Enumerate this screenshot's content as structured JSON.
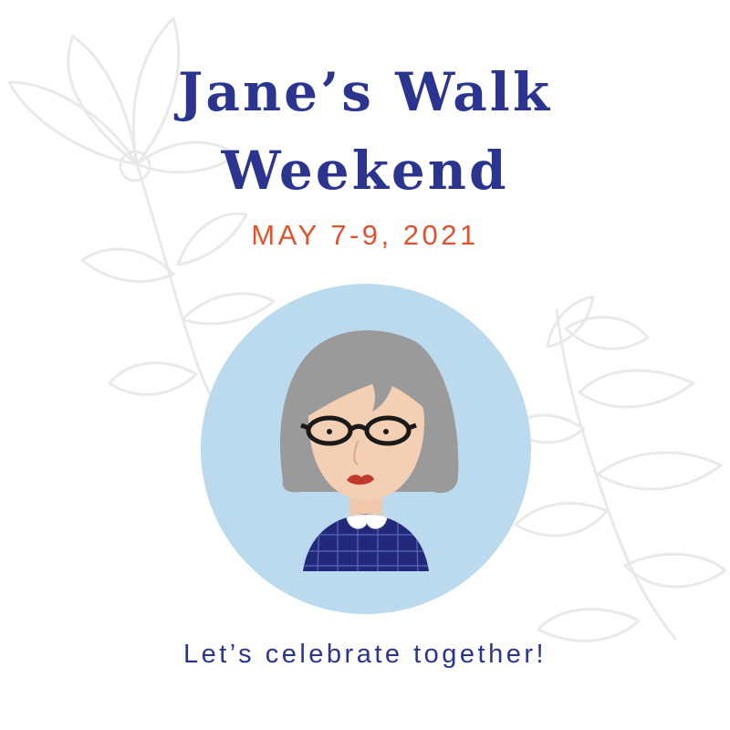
{
  "poster": {
    "title_line_1": "Jane’s Walk",
    "title_line_2": "Weekend",
    "date": "MAY 7-9, 2021",
    "tagline": "Let’s celebrate together!"
  },
  "colors": {
    "title": "#2b3590",
    "date": "#e0512c",
    "tagline": "#2b3590",
    "circle": "#bcdaee",
    "hair": "#999999",
    "skin": "#f3cfb4",
    "sweater": "#22297a",
    "lips": "#c0392b",
    "floral_outline": "#ececec"
  },
  "icons": {
    "background": "floral-line-art",
    "portrait": "jane-jacobs-illustration"
  }
}
